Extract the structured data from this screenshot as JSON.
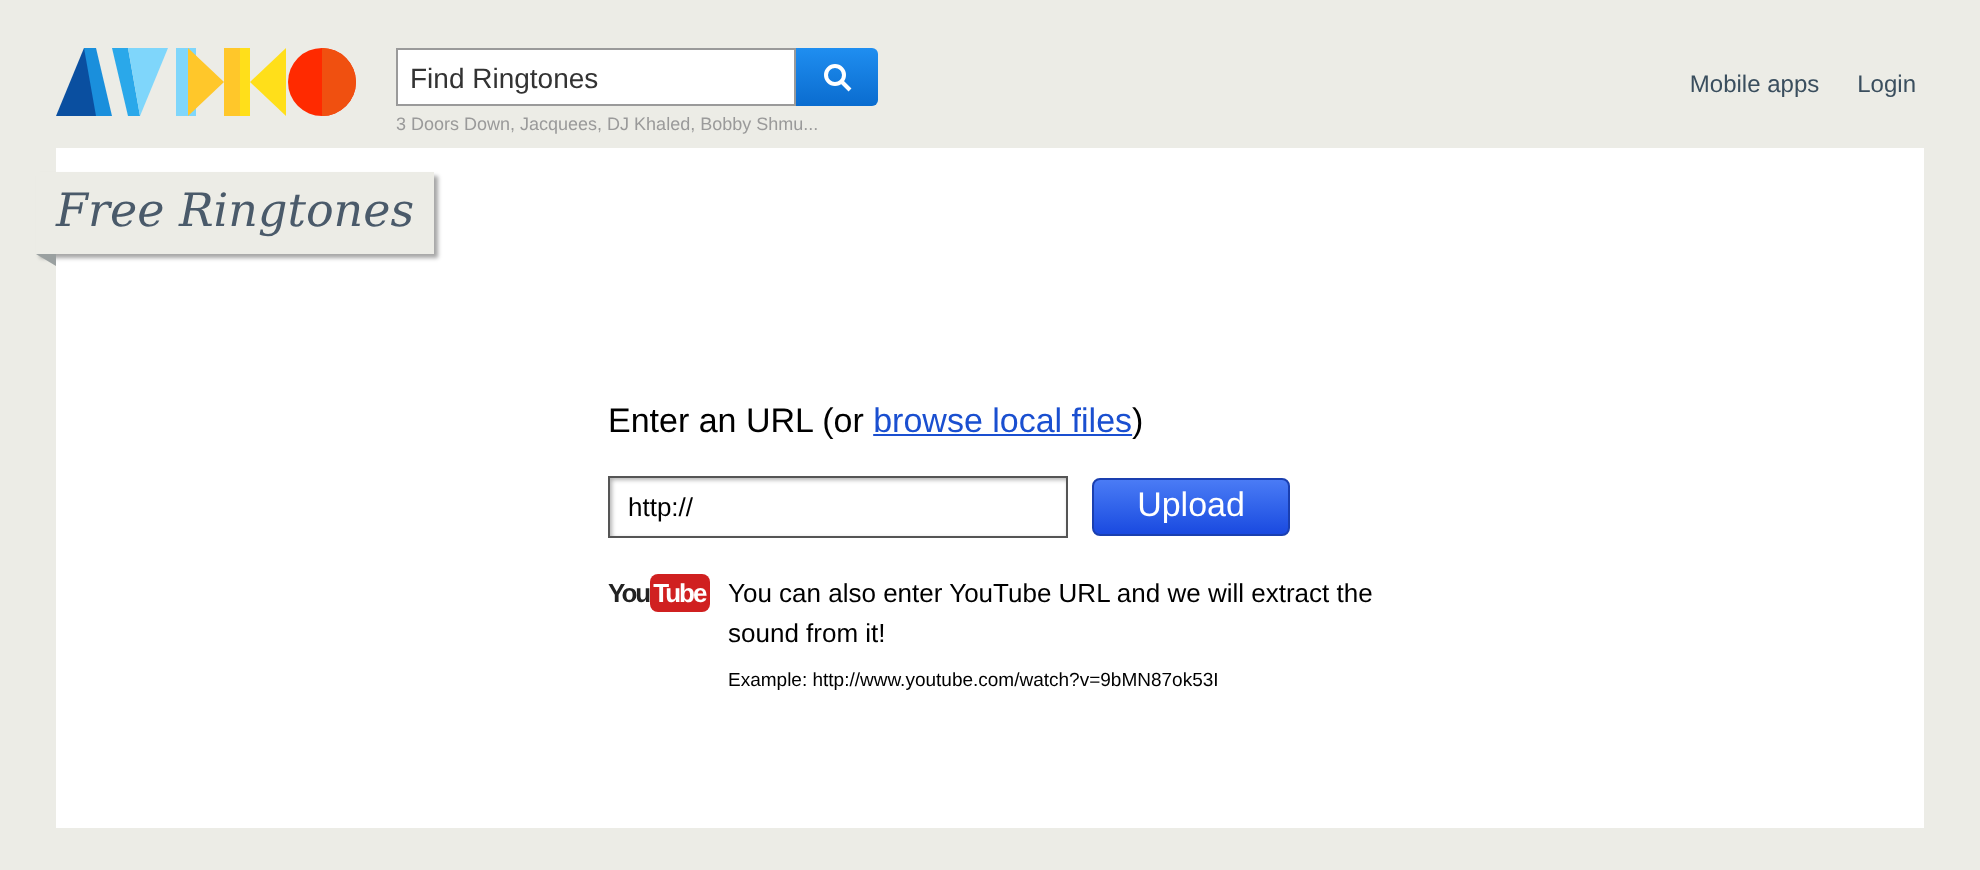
{
  "header": {
    "search": {
      "placeholder": "Find Ringtones",
      "suggestions": "3 Doors Down, Jacquees, DJ Khaled, Bobby Shmu..."
    },
    "nav": [
      "Mobile apps",
      "Login"
    ]
  },
  "ribbon": {
    "title": "Free Ringtones"
  },
  "upload": {
    "prompt_before": "Enter an URL (or ",
    "link": "browse local files",
    "prompt_after": ")",
    "url_value": "http://",
    "button": "Upload"
  },
  "youtube": {
    "logo_left": "You",
    "logo_right": "Tube",
    "text": "You can also enter YouTube URL and we will extract the sound from it!",
    "example": "Example: http://www.youtube.com/watch?v=9bMN87ok53I"
  }
}
